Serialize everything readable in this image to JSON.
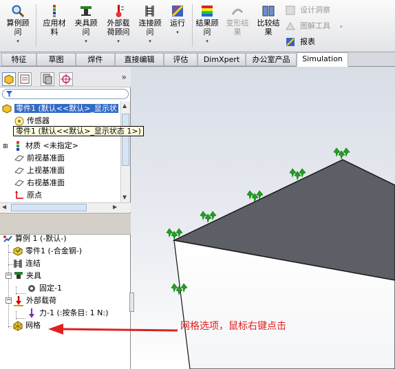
{
  "ribbon": {
    "buttons": [
      {
        "label": "算例顾\n问",
        "icon": "study-advisor-icon"
      },
      {
        "label": "应用材\n料",
        "icon": "apply-material-icon"
      },
      {
        "label": "夹具顾\n问",
        "icon": "fixtures-advisor-icon"
      },
      {
        "label": "外部载\n荷顾问",
        "icon": "external-loads-advisor-icon"
      },
      {
        "label": "连接顾\n问",
        "icon": "connections-advisor-icon"
      },
      {
        "label": "运行",
        "icon": "run-icon"
      },
      {
        "label": "结果顾\n问",
        "icon": "results-advisor-icon"
      },
      {
        "label": "变形结\n果",
        "icon": "deformed-result-icon"
      },
      {
        "label": "比较结\n果",
        "icon": "compare-results-icon"
      }
    ],
    "side_items": [
      {
        "label": "设计洞察",
        "icon": "design-insight-icon"
      },
      {
        "label": "图解工具",
        "icon": "plot-tools-icon"
      },
      {
        "label": "报表",
        "icon": "report-icon"
      }
    ]
  },
  "tabs": [
    "特征",
    "草图",
    "焊件",
    "直接编辑",
    "评估",
    "DimXpert",
    "办公室产品",
    "Simulation"
  ],
  "feature_tree": {
    "selected_row": "零件1    (默认<<默认>_显示状",
    "tooltip": "零件1    (默认<<默认>_显示状态 1>)",
    "rows": [
      "传感器",
      "材质 <未指定>",
      "前视基准面",
      "上视基准面",
      "右视基准面",
      "原点"
    ]
  },
  "study_tree": {
    "root": "算例 1 (-默认-)",
    "part": "零件1 (-合金钢-)",
    "connections": "连结",
    "fixtures": "夹具",
    "fixed": "固定-1",
    "external_loads": "外部载荷",
    "force": "力-1 (:按条目: 1 N:)",
    "mesh": "网格"
  },
  "annotation": "网格选项，鼠标右键点击",
  "colors": {
    "annotation": "#e0201f",
    "selection": "#316ac5",
    "model_top": "#5c5f66",
    "fixture_glyph": "#1fa31f"
  }
}
